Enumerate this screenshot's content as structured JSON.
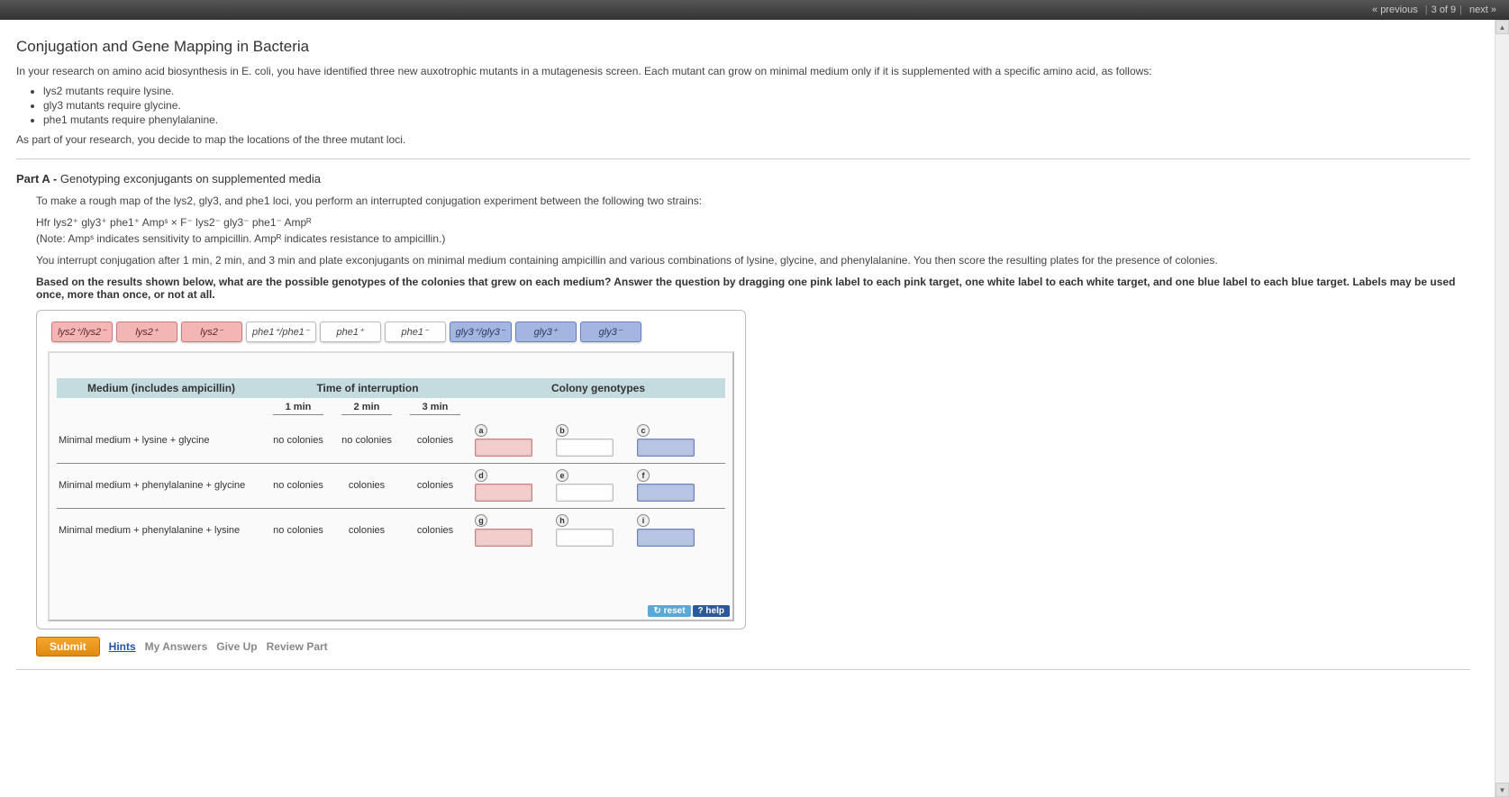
{
  "nav": {
    "prev": "« previous",
    "pos": "3 of 9",
    "next": "next »"
  },
  "title": "Conjugation and Gene Mapping in Bacteria",
  "intro": "In your research on amino acid biosynthesis in E. coli, you have identified three new auxotrophic mutants in a mutagenesis screen. Each mutant can grow on minimal medium only if it is supplemented with a specific amino acid, as follows:",
  "bullets": [
    "lys2 mutants require lysine.",
    "gly3 mutants require glycine.",
    "phe1 mutants require phenylalanine."
  ],
  "intro2": "As part of your research, you decide to map the locations of the three mutant loci.",
  "partA": {
    "label": "Part A - ",
    "title": "Genotyping exconjugants on supplemented media",
    "p1": "To make a rough map of the lys2, gly3, and phe1 loci, you perform an interrupted conjugation experiment between the following two strains:",
    "cross": "Hfr lys2⁺ gly3⁺ phe1⁺ Ampˢ × F⁻ lys2⁻ gly3⁻ phe1⁻ Ampᴿ",
    "note": "(Note: Ampˢ indicates sensitivity to ampicillin. Ampᴿ indicates resistance to ampicillin.)",
    "p2": "You interrupt conjugation after 1 min, 2 min, and 3 min and plate exconjugants on minimal medium containing ampicillin and various combinations of lysine, glycine, and phenylalanine. You then score the resulting plates for the presence of colonies.",
    "p3": "Based on the results shown below, what are the possible genotypes of the colonies that grew on each medium? Answer the question by dragging one pink label to each pink target, one white label to each white target, and one blue label to each blue target. Labels may be used once, more than once, or not at all."
  },
  "labels": {
    "pink": [
      "lys2⁺/lys2⁻",
      "lys2⁺",
      "lys2⁻"
    ],
    "white": [
      "phe1⁺/phe1⁻",
      "phe1⁺",
      "phe1⁻"
    ],
    "blue": [
      "gly3⁺/gly3⁻",
      "gly3⁺",
      "gly3⁻"
    ]
  },
  "tableHeaders": {
    "medium": "Medium (includes ampicillin)",
    "time": "Time of interruption",
    "geno": "Colony genotypes"
  },
  "timeCols": [
    "1 min",
    "2 min",
    "3 min"
  ],
  "rows": [
    {
      "medium": "Minimal medium + lysine + glycine",
      "cells": [
        "no colonies",
        "no colonies",
        "colonies"
      ],
      "letters": [
        "a",
        "b",
        "c"
      ]
    },
    {
      "medium": "Minimal medium + phenylalanine + glycine",
      "cells": [
        "no colonies",
        "colonies",
        "colonies"
      ],
      "letters": [
        "d",
        "e",
        "f"
      ]
    },
    {
      "medium": "Minimal medium + phenylalanine + lysine",
      "cells": [
        "no colonies",
        "colonies",
        "colonies"
      ],
      "letters": [
        "g",
        "h",
        "i"
      ]
    }
  ],
  "buttons": {
    "reset": "reset",
    "help": "? help",
    "submit": "Submit",
    "hints": "Hints",
    "myanswers": "My Answers",
    "giveup": "Give Up",
    "review": "Review Part"
  }
}
